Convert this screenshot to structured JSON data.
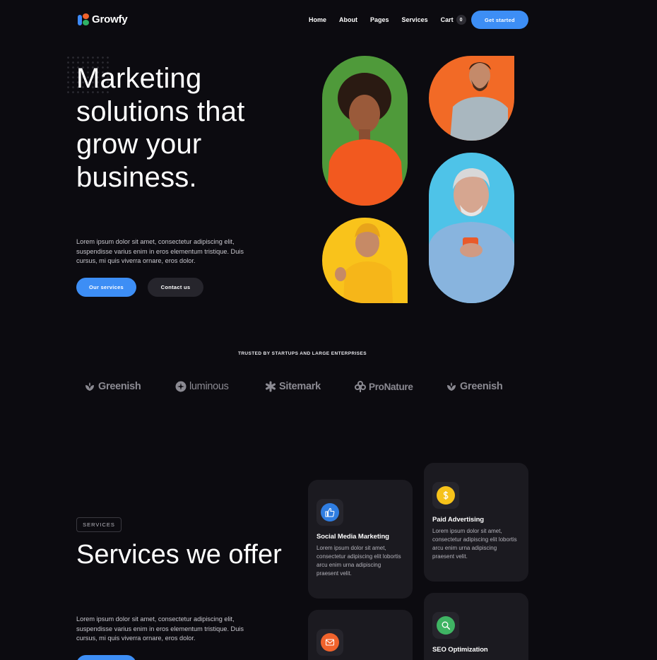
{
  "brand": {
    "name": "Growfy"
  },
  "nav": {
    "items": [
      "Home",
      "About",
      "Pages",
      "Services"
    ],
    "cart_label": "Cart",
    "cart_count": "0",
    "cta": "Get started"
  },
  "hero": {
    "title": "Marketing solutions that grow your business.",
    "text": "Lorem ipsum dolor sit amet, consectetur adipiscing elit, suspendisse varius enim in eros elementum tristique. Duis cursus, mi quis viverra ornare, eros dolor.",
    "primary_button": "Our services",
    "secondary_button": "Contact us"
  },
  "trusted": {
    "heading": "TRUSTED BY STARTUPS AND LARGE ENTERPRISES",
    "logos": [
      "Greenish",
      "luminous",
      "Sitemark",
      "ProNature",
      "Greenish"
    ]
  },
  "services": {
    "badge": "SERVICES",
    "title": "Services we offer",
    "text": "Lorem ipsum dolor sit amet, consectetur adipiscing elit, suspendisse varius enim in eros elementum tristique. Duis cursus, mi quis viverra ornare, eros dolor.",
    "cards": [
      {
        "title": "Social Media Marketing",
        "text": "Lorem ipsum dolor sit amet, consectetur adipiscing elit lobortis arcu enim urna adipiscing praesent velit.",
        "icon": "thumbs-up-icon",
        "color": "#2f7de1"
      },
      {
        "title": "Paid Advertising",
        "text": "Lorem ipsum dolor sit amet, consectetur adipiscing elit lobortis arcu enim urna adipiscing praesent velit.",
        "icon": "dollar-icon",
        "color": "#f6c21a"
      },
      {
        "title": "",
        "text": "",
        "icon": "mail-icon",
        "color": "#f0632c"
      },
      {
        "title": "SEO Optimization",
        "text": "",
        "icon": "search-icon",
        "color": "#3fb463"
      }
    ]
  },
  "colors": {
    "accent": "#3d8ef5",
    "background": "#0c0b10",
    "card": "#1b1a20"
  }
}
